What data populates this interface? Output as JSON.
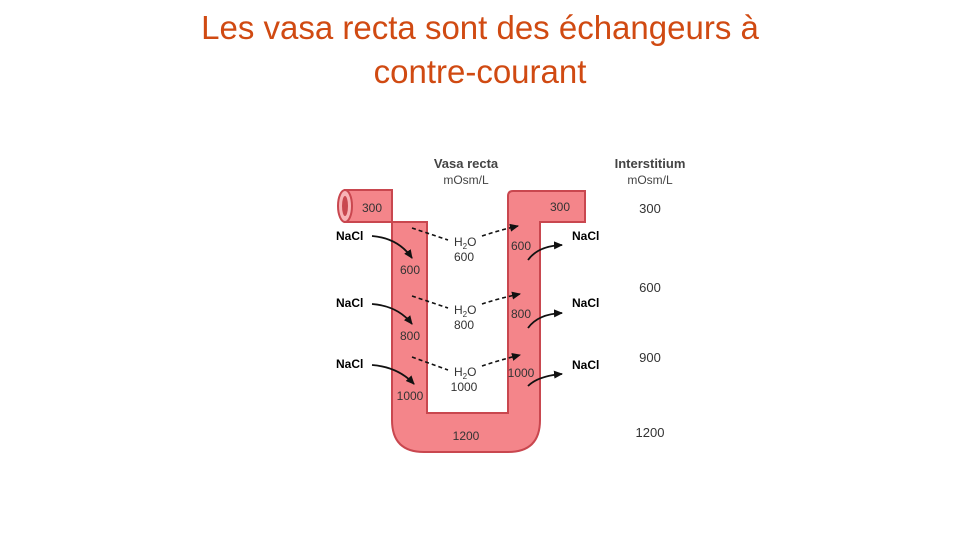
{
  "title": {
    "line1": "Les vasa recta sont des échangeurs à",
    "line2": "contre-courant"
  },
  "headers": {
    "vasa": "Vasa recta",
    "vasa_unit": "mOsm/L",
    "inter": "Interstitium",
    "inter_unit": "mOsm/L"
  },
  "vessel": {
    "desc_values": [
      "300",
      "600",
      "800",
      "1000"
    ],
    "bottom_value": "1200",
    "asc_values": [
      "300",
      "600",
      "800",
      "1000"
    ]
  },
  "water": {
    "label": "H",
    "sub": "2",
    "tail": "O",
    "values": [
      "600",
      "800",
      "1000"
    ]
  },
  "nacl_label": "NaCl",
  "interstitium_values": [
    "300",
    "600",
    "900",
    "1200"
  ],
  "colors": {
    "title": "#d04a12",
    "vessel_fill": "#f4858a",
    "vessel_stroke": "#c9474f"
  }
}
